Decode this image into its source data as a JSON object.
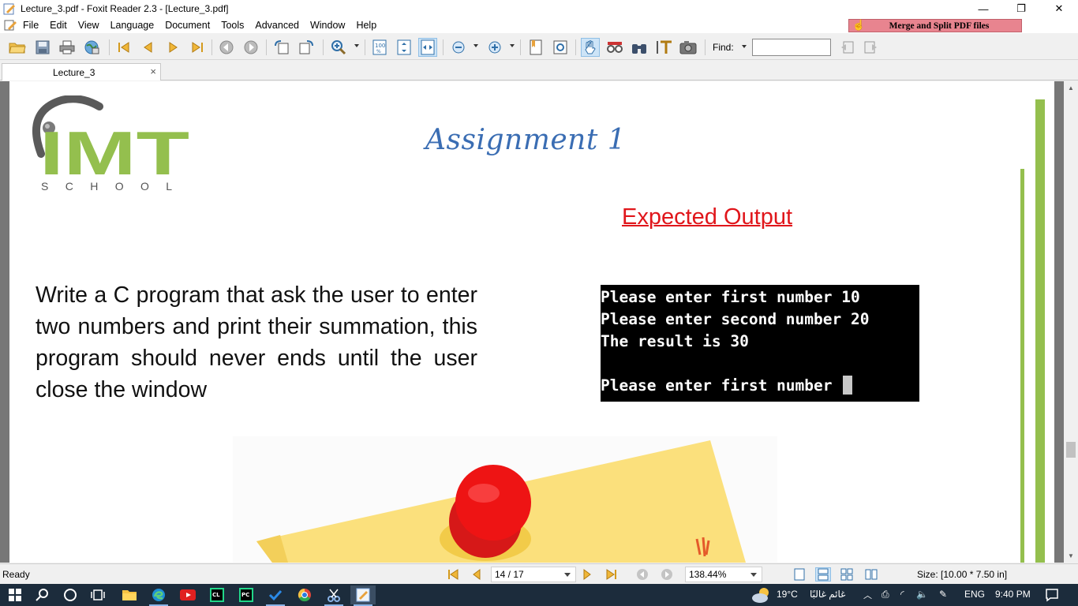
{
  "window": {
    "title": "Lecture_3.pdf - Foxit Reader 2.3 - [Lecture_3.pdf]",
    "minimize": "—",
    "restore": "❐",
    "close": "✕"
  },
  "menu": [
    "File",
    "Edit",
    "View",
    "Language",
    "Document",
    "Tools",
    "Advanced",
    "Window",
    "Help"
  ],
  "banner": {
    "label": "Merge and Split PDF files"
  },
  "toolbar": {
    "find_label": "Find:",
    "find_value": ""
  },
  "tab": {
    "label": "Lecture_3",
    "close": "×"
  },
  "page": {
    "logo_letters": "IMT",
    "logo_subtitle": "S C H O O L",
    "title": "Assignment 1",
    "expected_heading": "Expected Output",
    "task_text": "Write a C program that ask the user to enter two numbers and print their summation, this program should never ends until the user close the window",
    "console_lines": [
      "Please enter first number 10",
      "Please enter second number 20",
      "The result is 30",
      "",
      "Please enter first number "
    ]
  },
  "status": {
    "ready": "Ready",
    "page_indicator": "14 / 17",
    "zoom": "138.44%",
    "size": "Size: [10.00 * 7.50 in]"
  },
  "taskbar": {
    "weather": "19°C",
    "weather_desc": "غائم غالبًا",
    "language": "ENG",
    "time": "9:40 PM"
  },
  "colors": {
    "accent_green": "#94bf4e",
    "title_blue": "#3a6db3",
    "heading_red": "#e0161b",
    "banner_pink": "#e8848f"
  }
}
